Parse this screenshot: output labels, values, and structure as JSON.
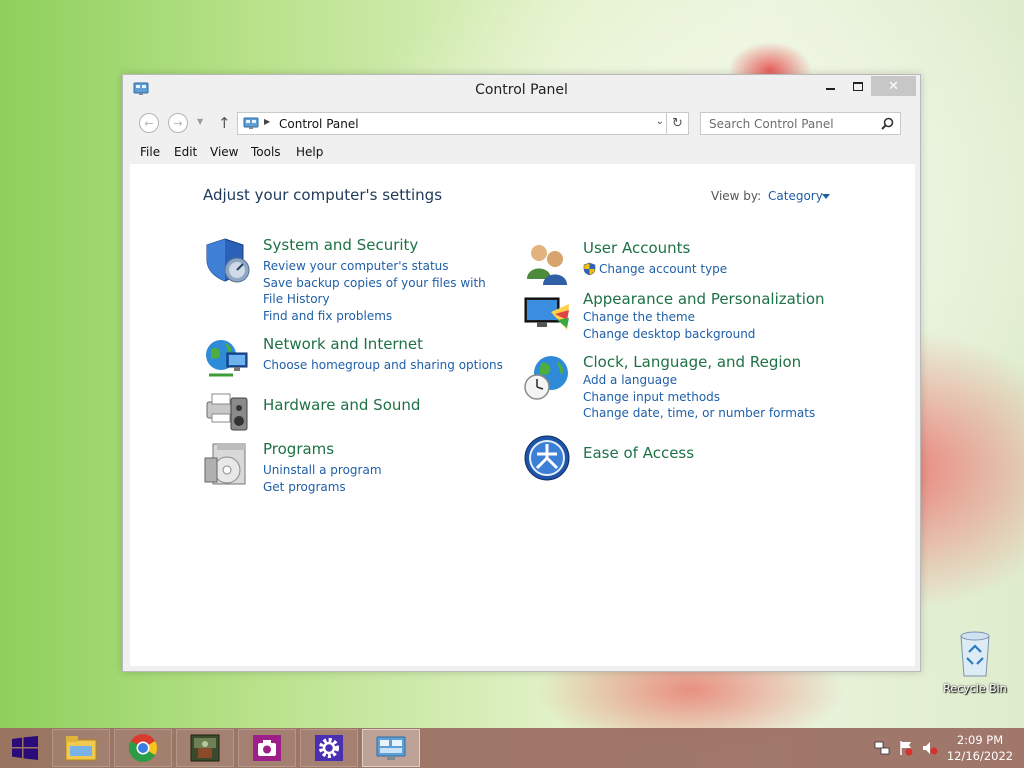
{
  "window": {
    "title": "Control Panel",
    "close_glyph": "✕",
    "back_glyph": "←",
    "forward_glyph": "→",
    "up_glyph": "↑",
    "refresh_glyph": "↻",
    "dropdown_glyph": "⌄"
  },
  "address": {
    "path": "Control Panel"
  },
  "search": {
    "placeholder": "Search Control Panel"
  },
  "menu": [
    "File",
    "Edit",
    "View",
    "Tools",
    "Help"
  ],
  "content": {
    "heading": "Adjust your computer's settings",
    "view_by_label": "View by:",
    "view_by_value": "Category"
  },
  "categories": {
    "system_security": {
      "title": "System and Security",
      "icon": "shield-icon",
      "links": [
        "Review your computer's status",
        "Save backup copies of your files with File History",
        "Find and fix problems"
      ]
    },
    "network": {
      "title": "Network and Internet",
      "icon": "network-globe-icon",
      "links": [
        "Choose homegroup and sharing options"
      ]
    },
    "hardware": {
      "title": "Hardware and Sound",
      "icon": "printer-speaker-icon",
      "links": []
    },
    "programs": {
      "title": "Programs",
      "icon": "programs-disc-icon",
      "links": [
        "Uninstall a program",
        "Get programs"
      ]
    },
    "user_accounts": {
      "title": "User Accounts",
      "icon": "users-icon",
      "links": [
        "Change account type"
      ]
    },
    "appearance": {
      "title": "Appearance and Personalization",
      "icon": "monitor-paint-icon",
      "links": [
        "Change the theme",
        "Change desktop background"
      ]
    },
    "clock": {
      "title": "Clock, Language, and Region",
      "icon": "clock-globe-icon",
      "links": [
        "Add a language",
        "Change input methods",
        "Change date, time, or number formats"
      ]
    },
    "ease": {
      "title": "Ease of Access",
      "icon": "ease-of-access-icon",
      "links": []
    }
  },
  "desktop": {
    "recycle_bin_label": "Recycle Bin"
  },
  "taskbar": {
    "apps": [
      "file-explorer-icon",
      "chrome-icon",
      "game-icon",
      "camera-app-icon",
      "settings-gear-icon",
      "control-panel-icon"
    ],
    "time": "2:09 PM",
    "date": "12/16/2022"
  },
  "colors": {
    "link": "#1f5fa8",
    "category_title": "#1e7145",
    "heading": "#1e395b",
    "taskbar": "#9a6c62"
  }
}
